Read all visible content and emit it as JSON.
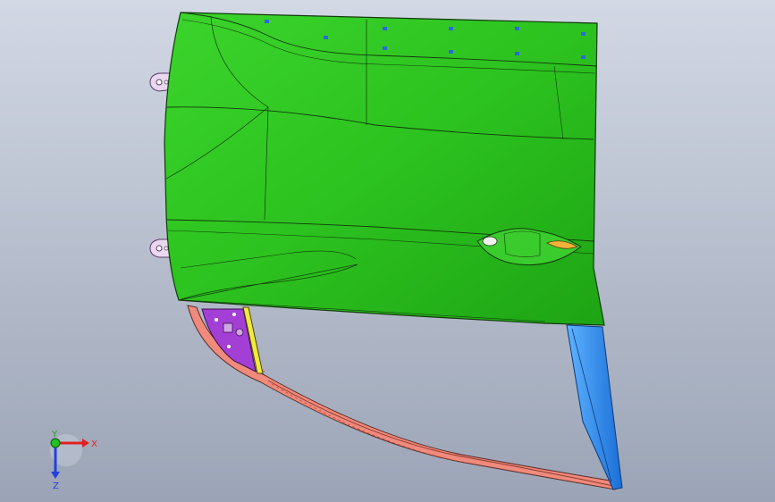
{
  "viewport": {
    "background_top": "#cfd6e3",
    "background_bottom": "#9aa3b6"
  },
  "model": {
    "door_outer_panel_color": "#2cc21f",
    "door_outer_panel_edge": "#123a0c",
    "inner_reinforcement_color": "#a43fd6",
    "window_frame_color": "#f08a7c",
    "rear_channel_color": "#2e8ef0",
    "hinge_bracket_color": "#e9d8f0",
    "latch_highlight_color": "#f2b23a",
    "strip_color": "#f2ea3a"
  },
  "triad": {
    "x_label": "X",
    "y_label": "Y",
    "z_label": "Z",
    "x_color": "#e02020",
    "y_color": "#20c020",
    "z_color": "#2040e0"
  }
}
